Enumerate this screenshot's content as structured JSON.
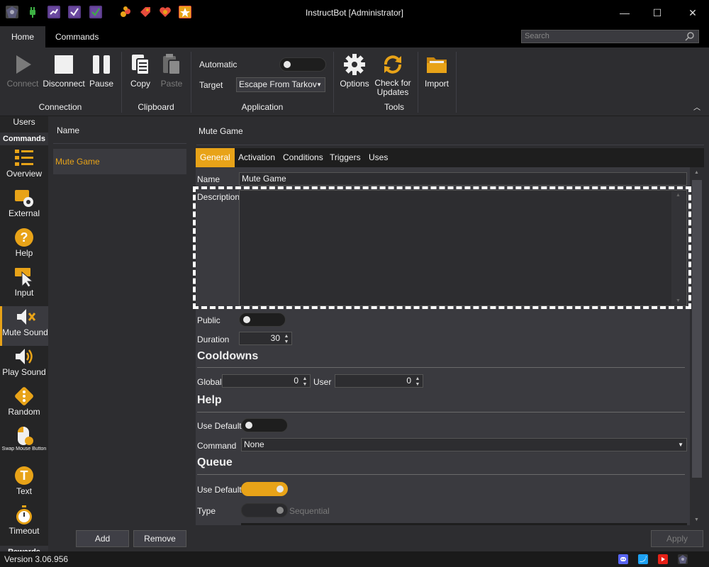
{
  "window": {
    "title": "InstructBot [Administrator]",
    "controls": {
      "minimize": "—",
      "maximize": "☐",
      "close": "✕"
    }
  },
  "ribbon_tabs": {
    "home": "Home",
    "commands": "Commands"
  },
  "search": {
    "placeholder": "Search"
  },
  "ribbon": {
    "connection": {
      "label": "Connection",
      "connect": "Connect",
      "disconnect": "Disconnect",
      "pause": "Pause"
    },
    "clipboard": {
      "label": "Clipboard",
      "copy": "Copy",
      "paste": "Paste"
    },
    "application": {
      "label": "Application",
      "automatic_label": "Automatic",
      "automatic_on": false,
      "target_label": "Target",
      "target_value": "Escape From Tarkov"
    },
    "tools": {
      "label": "Tools",
      "options": "Options",
      "check_updates": "Check for\nUpdates"
    },
    "import": "Import"
  },
  "nav": {
    "users": "Users",
    "commands_header": "Commands",
    "items": [
      {
        "label": "Overview",
        "icon": "list-icon"
      },
      {
        "label": "External",
        "icon": "external-gear-icon"
      },
      {
        "label": "Help",
        "icon": "question-icon"
      },
      {
        "label": "Input",
        "icon": "keyboard-cursor-icon"
      },
      {
        "label": "Mute Sound",
        "icon": "speaker-mute-icon"
      },
      {
        "label": "Play Sound",
        "icon": "speaker-icon"
      },
      {
        "label": "Random",
        "icon": "dice-icon"
      },
      {
        "label": "Swap Mouse Button",
        "icon": "mouse-icon"
      },
      {
        "label": "Text",
        "icon": "text-icon"
      },
      {
        "label": "Timeout",
        "icon": "timer-icon"
      }
    ],
    "rewards_header": "Rewards",
    "active_index": 4
  },
  "list": {
    "header": "Name",
    "rows": [
      "Mute Game"
    ],
    "add": "Add",
    "remove": "Remove"
  },
  "detail": {
    "title": "Mute Game",
    "tabs": [
      "General",
      "Activation",
      "Conditions",
      "Triggers",
      "Uses"
    ],
    "active_tab": "General",
    "name_label": "Name",
    "name_value": "Mute Game",
    "description_label": "Description",
    "description_value": "",
    "public_label": "Public",
    "public_on": false,
    "duration_label": "Duration",
    "duration_value": "30",
    "cooldowns_header": "Cooldowns",
    "global_label": "Global",
    "global_value": "0",
    "user_label": "User",
    "user_value": "0",
    "help_header": "Help",
    "help_use_default_label": "Use Default",
    "help_use_default_on": false,
    "command_label": "Command",
    "command_value": "None",
    "queue_header": "Queue",
    "queue_use_default_label": "Use Default",
    "queue_use_default_on": true,
    "type_label": "Type",
    "type_value": "Sequential",
    "apply": "Apply"
  },
  "status": {
    "version": "Version 3.06.956",
    "icons": [
      "discord-icon",
      "twitter-icon",
      "youtube-icon",
      "app-logo-icon"
    ]
  },
  "colors": {
    "accent": "#e8a318",
    "background": "#2d2d30",
    "titlebar": "#000000"
  }
}
